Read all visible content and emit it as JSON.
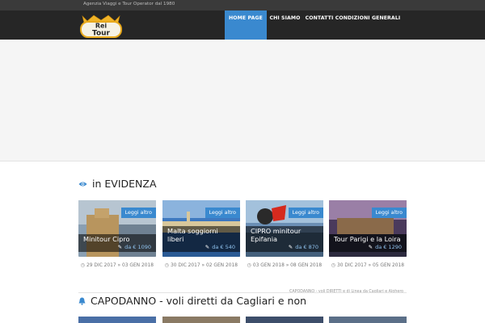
{
  "topbar": {
    "tagline": "Agenzia Viaggi e Tour Operator dal 1980"
  },
  "logo": {
    "line1": "Rei",
    "line2": "Tour"
  },
  "nav": [
    {
      "label": "HOME PAGE",
      "active": true
    },
    {
      "label": "CHI SIAMO",
      "active": false
    },
    {
      "label": "CONTATTI",
      "active": false
    },
    {
      "label": "CONDIZIONI GENERALI",
      "active": false
    }
  ],
  "sections": {
    "evidenza": {
      "title": "in EVIDENZA",
      "icon": "eye-icon"
    },
    "capodanno": {
      "title": "CAPODANNO - voli diretti da Cagliari e non",
      "icon": "bell-icon"
    }
  },
  "cards": [
    {
      "button": "Leggi altro",
      "name": "Minitour Cipro",
      "price": "da € 1090",
      "date": "29 DIC 2017 » 03 GEN 2018"
    },
    {
      "button": "Leggi altro",
      "name": "Malta soggiorni liberi",
      "price": "da € 540",
      "date": "30 DIC 2017 » 02 GEN 2018"
    },
    {
      "button": "Leggi altro",
      "name": "CIPRO minitour Epifania",
      "price": "da € 870",
      "date": "03 GEN 2018 » 08 GEN 2018"
    },
    {
      "button": "Leggi altro",
      "name": "Tour Parigi e la Loira",
      "price": "da € 1290",
      "date": "30 DIC 2017 » 05 GEN 2018"
    }
  ],
  "ticker": "CAPODANNO - voli DIRETTI e di Linea da Cagliari e Alghero",
  "colors": {
    "accent": "#3a89cf",
    "navbar": "#262626",
    "topbar": "#3a3a3a"
  }
}
